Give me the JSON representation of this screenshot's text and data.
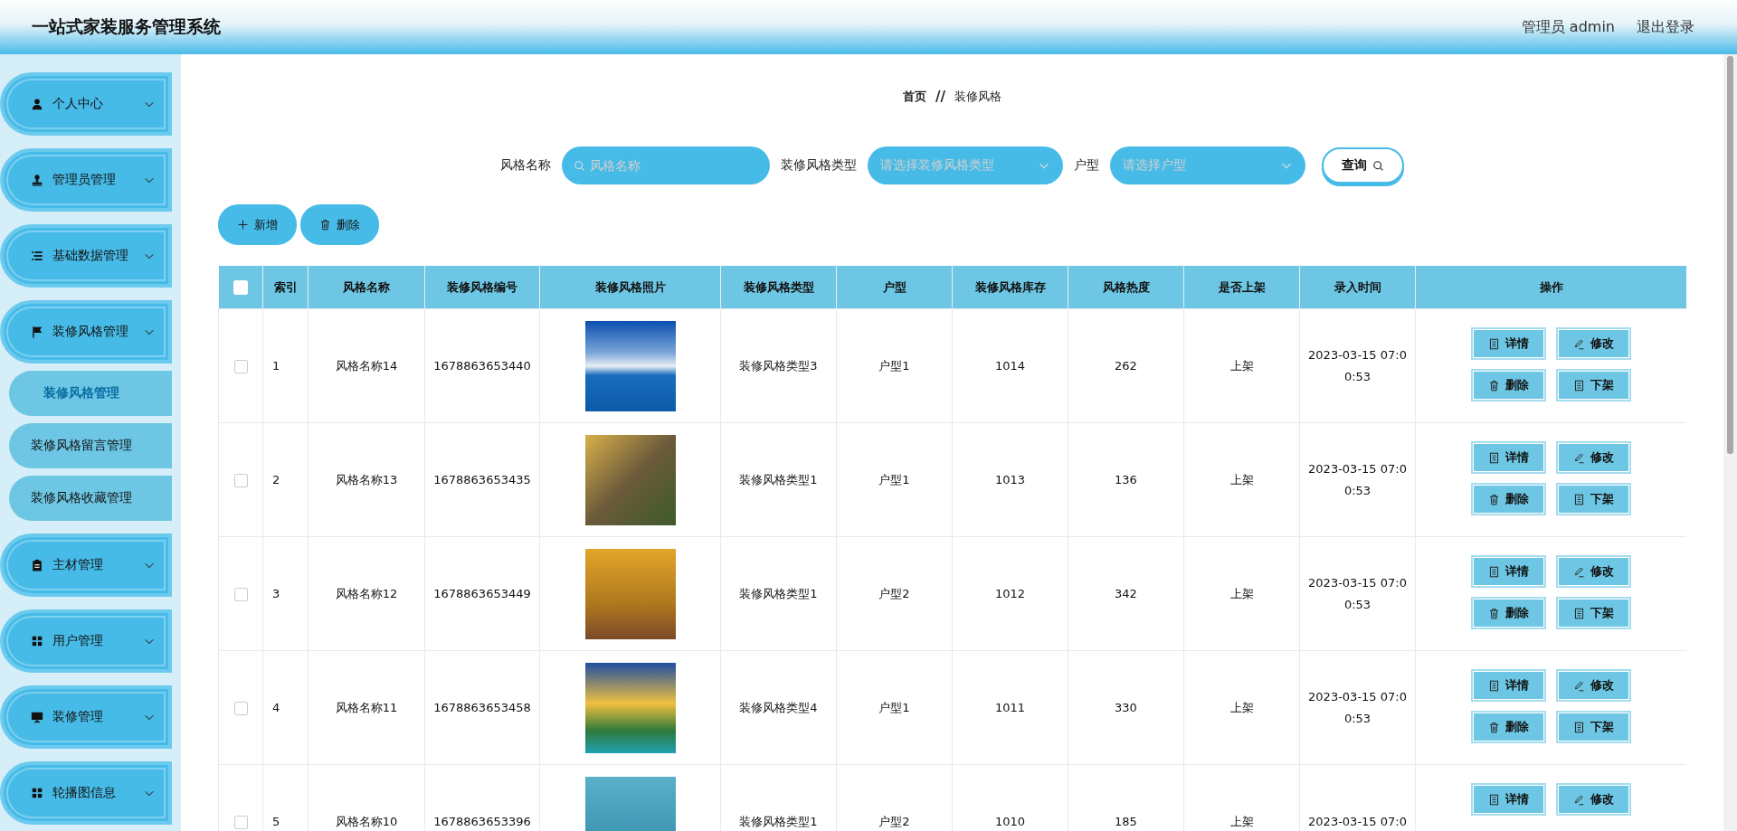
{
  "header": {
    "title": "一站式家装服务管理系统",
    "user": "管理员 admin",
    "logout": "退出登录"
  },
  "sidebar": {
    "items": [
      {
        "label": "个人中心"
      },
      {
        "label": "管理员管理"
      },
      {
        "label": "基础数据管理"
      },
      {
        "label": "装修风格管理",
        "children": [
          {
            "label": "装修风格管理",
            "selected": true
          },
          {
            "label": "装修风格留言管理",
            "selected": false
          },
          {
            "label": "装修风格收藏管理",
            "selected": false
          }
        ]
      },
      {
        "label": "主材管理"
      },
      {
        "label": "用户管理"
      },
      {
        "label": "装修管理"
      },
      {
        "label": "轮播图信息"
      }
    ]
  },
  "breadcrumb": {
    "items": [
      "首页",
      "装修风格"
    ],
    "separator": "//"
  },
  "search": {
    "fields": [
      {
        "kind": "text",
        "label": "风格名称",
        "placeholder": "风格名称"
      },
      {
        "kind": "select",
        "label": "装修风格类型",
        "placeholder": "请选择装修风格类型"
      },
      {
        "kind": "select",
        "label": "户型",
        "placeholder": "请选择户型"
      }
    ],
    "button": "查询"
  },
  "toolbar": [
    {
      "kind": "add",
      "label": "新增"
    },
    {
      "kind": "delete",
      "label": "删除"
    }
  ],
  "table": {
    "all_selected": false,
    "columns": [
      "索引",
      "风格名称",
      "装修风格编号",
      "装修风格照片",
      "装修风格类型",
      "户型",
      "装修风格库存",
      "风格热度",
      "是否上架",
      "录入时间",
      "操作"
    ],
    "rows": [
      {
        "selected": false,
        "cells": [
          "1",
          "风格名称14",
          "1678863653440",
          null,
          "装修风格类型3",
          "户型1",
          "1014",
          "262",
          "上架",
          "2023-03-15 07:00:53"
        ],
        "actions": [
          {
            "kind": "detail",
            "label": "详情"
          },
          {
            "kind": "edit",
            "label": "修改"
          },
          {
            "kind": "delete",
            "label": "删除"
          },
          {
            "kind": "unshelf",
            "label": "下架"
          }
        ]
      },
      {
        "selected": false,
        "cells": [
          "2",
          "风格名称13",
          "1678863653435",
          null,
          "装修风格类型1",
          "户型1",
          "1013",
          "136",
          "上架",
          "2023-03-15 07:00:53"
        ],
        "actions": [
          {
            "kind": "detail",
            "label": "详情"
          },
          {
            "kind": "edit",
            "label": "修改"
          },
          {
            "kind": "delete",
            "label": "删除"
          },
          {
            "kind": "unshelf",
            "label": "下架"
          }
        ]
      },
      {
        "selected": false,
        "cells": [
          "3",
          "风格名称12",
          "1678863653449",
          null,
          "装修风格类型1",
          "户型2",
          "1012",
          "342",
          "上架",
          "2023-03-15 07:00:53"
        ],
        "actions": [
          {
            "kind": "detail",
            "label": "详情"
          },
          {
            "kind": "edit",
            "label": "修改"
          },
          {
            "kind": "delete",
            "label": "删除"
          },
          {
            "kind": "unshelf",
            "label": "下架"
          }
        ]
      },
      {
        "selected": false,
        "cells": [
          "4",
          "风格名称11",
          "1678863653458",
          null,
          "装修风格类型4",
          "户型1",
          "1011",
          "330",
          "上架",
          "2023-03-15 07:00:53"
        ],
        "actions": [
          {
            "kind": "detail",
            "label": "详情"
          },
          {
            "kind": "edit",
            "label": "修改"
          },
          {
            "kind": "delete",
            "label": "删除"
          },
          {
            "kind": "unshelf",
            "label": "下架"
          }
        ]
      },
      {
        "selected": false,
        "cells": [
          "5",
          "风格名称10",
          "1678863653396",
          null,
          "装修风格类型1",
          "户型2",
          "1010",
          "185",
          "上架",
          "2023-03-15 07:0"
        ],
        "actions": [
          {
            "kind": "detail",
            "label": "详情"
          },
          {
            "kind": "edit",
            "label": "修改"
          }
        ]
      }
    ]
  }
}
